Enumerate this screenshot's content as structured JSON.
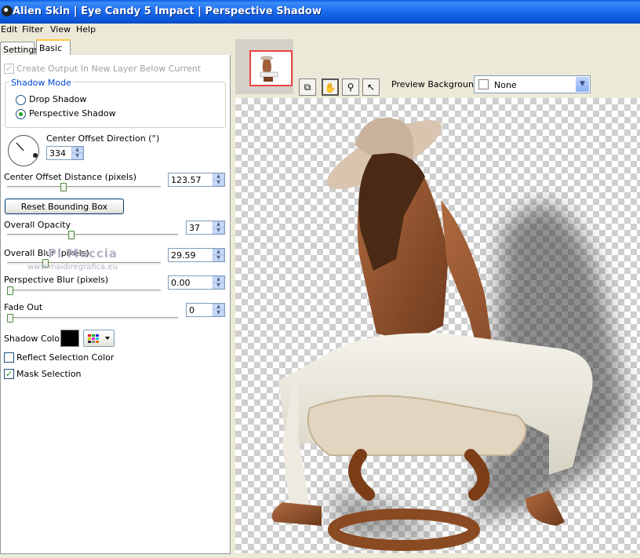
{
  "window": {
    "title": "Alien Skin  |  Eye Candy 5 Impact  |  Perspective Shadow"
  },
  "menu": [
    "Edit",
    "Filter",
    "View",
    "Help"
  ],
  "tabs": [
    {
      "label": "Settings",
      "active": false
    },
    {
      "label": "Basic",
      "active": true
    }
  ],
  "basic": {
    "create_output_label": "Create Output In New Layer Below Current",
    "create_output_checked": true,
    "create_output_enabled": false,
    "shadow_mode": {
      "title": "Shadow Mode",
      "options": [
        "Drop Shadow",
        "Perspective Shadow"
      ],
      "selected": "Perspective Shadow"
    },
    "center_offset_direction": {
      "label": "Center Offset Direction (°)",
      "value": "334"
    },
    "center_offset_distance": {
      "label": "Center Offset Distance (pixels)",
      "value": "123.57",
      "slider_fraction": 0.36
    },
    "reset_bounding_box": "Reset Bounding Box",
    "overall_opacity": {
      "label": "Overall Opacity",
      "value": "37",
      "slider_fraction": 0.37
    },
    "overall_blur": {
      "label": "Overall Blur (pixels)",
      "value": "29.59",
      "slider_fraction": 0.24
    },
    "perspective_blur": {
      "label": "Perspective Blur (pixels)",
      "value": "0.00",
      "slider_fraction": 0.0
    },
    "fade_out": {
      "label": "Fade Out",
      "value": "0",
      "slider_fraction": 0.0
    },
    "shadow_color": {
      "label": "Shadow Color",
      "color": "#000000"
    },
    "reflect_selection_color": {
      "label": "Reflect Selection Color",
      "checked": false
    },
    "mask_selection": {
      "label": "Mask Selection",
      "checked": true
    }
  },
  "watermark": {
    "line1": "Pi Muccia",
    "line2": "www.maidiregrafica.eu"
  },
  "preview_background": {
    "label": "Preview Background:",
    "value": "None"
  },
  "tools": [
    "preview-compare-icon",
    "hand-tool-icon",
    "zoom-tool-icon",
    "pointer-tool-icon"
  ],
  "colors": {
    "titlebar": "#0a5ee8",
    "shadow": "#000000",
    "accent_check": "#21a121"
  }
}
